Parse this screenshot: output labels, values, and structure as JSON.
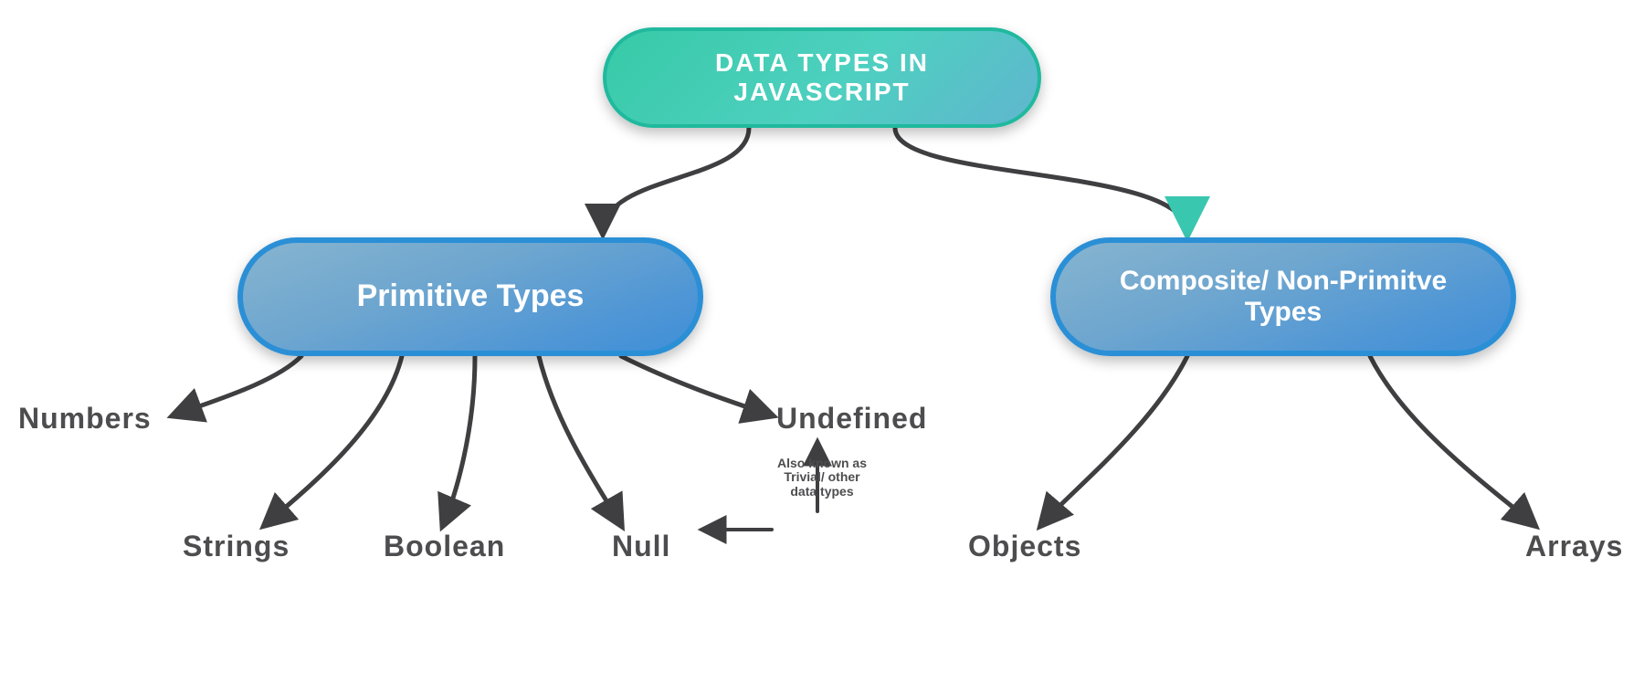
{
  "root": {
    "title": "DATA TYPES IN JAVASCRIPT"
  },
  "categories": {
    "primitive": {
      "label": "Primitive Types"
    },
    "composite": {
      "label": "Composite/ Non-Primitve Types"
    }
  },
  "leaves": {
    "numbers": "Numbers",
    "strings": "Strings",
    "boolean": "Boolean",
    "null": "Null",
    "undefined": "Undefined",
    "objects": "Objects",
    "arrays": "Arrays"
  },
  "annotation": {
    "trivial_note": "Also known as Trivial/ other data types"
  },
  "colors": {
    "root_gradient_from": "#37caa7",
    "root_gradient_to": "#60b6cf",
    "root_border": "#20b99e",
    "cat_gradient_from": "#86b4cf",
    "cat_gradient_to": "#3f8fd8",
    "cat_border": "#2b8fd6",
    "text_dark": "#4d4d4f",
    "connector": "#3f3f41"
  },
  "chart_data": {
    "type": "tree",
    "title": "DATA TYPES IN JAVASCRIPT",
    "root": "Data Types in JavaScript",
    "children": [
      {
        "name": "Primitive Types",
        "children": [
          {
            "name": "Numbers"
          },
          {
            "name": "Strings"
          },
          {
            "name": "Boolean"
          },
          {
            "name": "Null"
          },
          {
            "name": "Undefined"
          }
        ]
      },
      {
        "name": "Composite/ Non-Primitive Types",
        "children": [
          {
            "name": "Objects"
          },
          {
            "name": "Arrays"
          }
        ]
      }
    ],
    "annotations": [
      {
        "text": "Also known as Trivial/ other data types",
        "applies_to": [
          "Null",
          "Undefined"
        ]
      }
    ]
  }
}
